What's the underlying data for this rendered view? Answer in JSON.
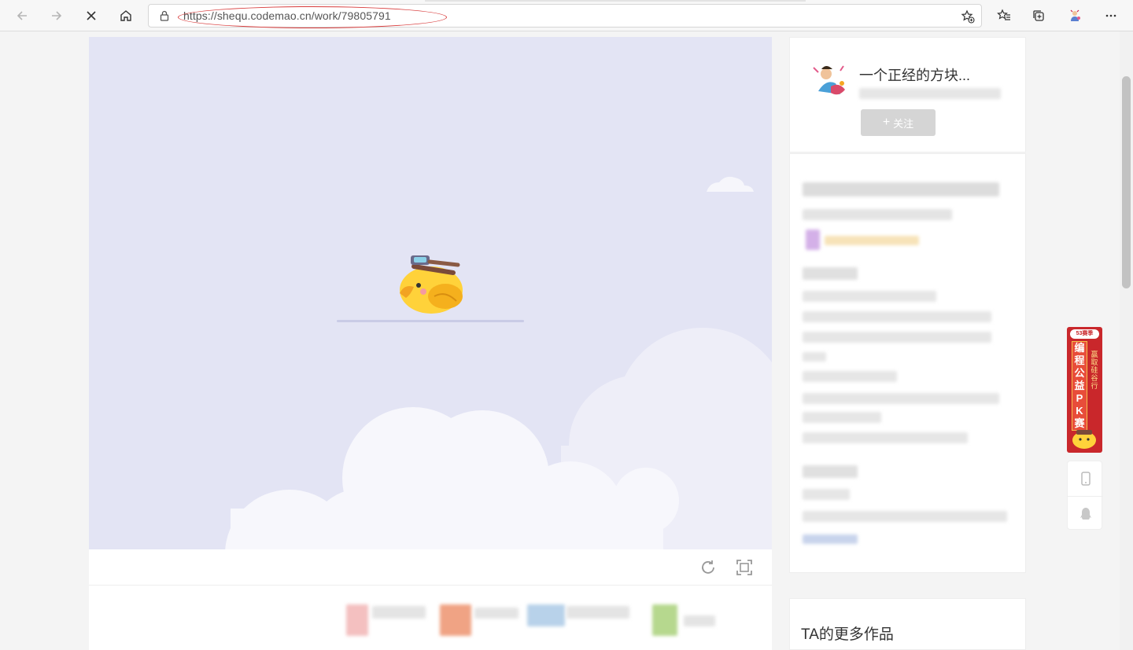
{
  "browser": {
    "url": "https://shequ.codemao.cn/work/79805791",
    "icons": [
      "back-icon",
      "forward-icon",
      "stop-icon",
      "home-icon",
      "lock-icon",
      "favorite-add-icon",
      "favorites-icon",
      "collections-icon",
      "profile-icon",
      "more-icon"
    ]
  },
  "author": {
    "name": "一个正经的方块...",
    "follow_label": "关注"
  },
  "more_works": {
    "title": "TA的更多作品"
  },
  "promo": {
    "badge": "53赛季",
    "main": [
      "编",
      "程",
      "公",
      "益",
      "P",
      "K",
      "赛"
    ],
    "side": [
      "赢",
      "取",
      "硅",
      "谷",
      "行"
    ]
  },
  "colors": {
    "stage_bg": "#e3e4f4",
    "promo_red": "#c9272b",
    "follow_btn": "#d5d5d5",
    "annotation": "#d83b3b"
  }
}
